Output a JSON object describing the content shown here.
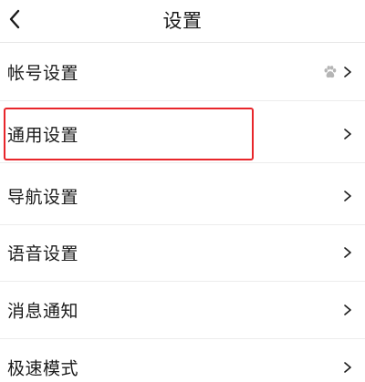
{
  "header": {
    "title": "设置",
    "back_icon": "chevron-left-icon"
  },
  "settings": {
    "items": [
      {
        "label": "帐号设置",
        "icon": "paw-icon",
        "chevron": "chevron-right-icon"
      },
      {
        "label": "通用设置",
        "chevron": "chevron-right-icon",
        "highlighted": true
      },
      {
        "label": "导航设置",
        "chevron": "chevron-right-icon"
      },
      {
        "label": "语音设置",
        "chevron": "chevron-right-icon"
      },
      {
        "label": "消息通知",
        "chevron": "chevron-right-icon"
      },
      {
        "label": "极速模式",
        "chevron": "chevron-right-icon"
      }
    ]
  },
  "colors": {
    "highlight": "#e8262b",
    "text": "#1a1a1a",
    "divider": "#ececec",
    "icon_gray": "#b5b5b5"
  }
}
